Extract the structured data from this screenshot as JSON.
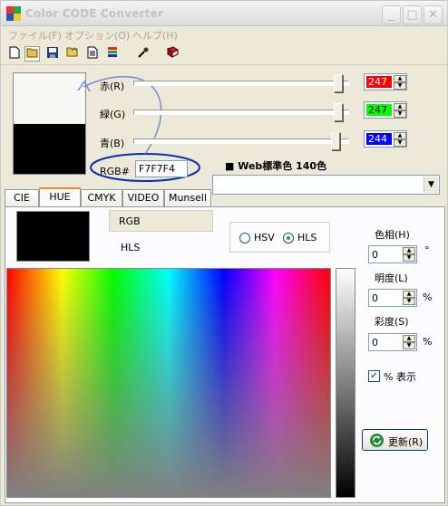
{
  "window": {
    "title": "Color CODE Converter"
  },
  "title_buttons": {
    "minimize": "_",
    "maximize": "□",
    "close": "✕"
  },
  "menu": [
    {
      "label": "ファイル(F)"
    },
    {
      "label": "オプション(O)"
    },
    {
      "label": "ヘルプ(H)"
    }
  ],
  "toolbar": [
    {
      "icon": "new-file-icon"
    },
    {
      "icon": "open-folder-icon"
    },
    {
      "icon": "save-icon"
    },
    {
      "icon": "open-icon"
    },
    {
      "icon": "document-icon"
    },
    {
      "icon": "palette-icon"
    },
    {
      "icon": "eyedropper-icon"
    },
    {
      "icon": "book-icon"
    }
  ],
  "colors": {
    "foreground": "#F7F7F4",
    "background": "#000000"
  },
  "sliders": [
    {
      "label": "赤(R)",
      "value": "247",
      "box_color": "#ff0000",
      "level": 0.969
    },
    {
      "label": "緑(G)",
      "value": "247",
      "box_color": "#00ff00",
      "level": 0.969
    },
    {
      "label": "青(B)",
      "value": "244",
      "box_color": "#0000ff",
      "level": 0.957
    }
  ],
  "rgb_code": {
    "label": "RGB#",
    "value": "F7F7F4"
  },
  "web_color": {
    "label": "■ Web標準色 140色",
    "selected": ""
  },
  "tabs": [
    {
      "label": "CIE",
      "active": false
    },
    {
      "label": "HUE",
      "active": true
    },
    {
      "label": "CMYK",
      "active": false
    },
    {
      "label": "VIDEO",
      "active": false
    },
    {
      "label": "Munsell",
      "active": false
    }
  ],
  "hue_panel": {
    "rgb_label": "RGB",
    "hls_label": "HLS",
    "mode_options": [
      {
        "label": "HSV",
        "selected": false
      },
      {
        "label": "HLS",
        "selected": true
      }
    ],
    "hue": {
      "label": "色相(H)",
      "value": "0",
      "unit": "°"
    },
    "lightness": {
      "label": "明度(L)",
      "value": "0",
      "unit": "%"
    },
    "saturation": {
      "label": "彩度(S)",
      "value": "0",
      "unit": "%"
    },
    "percent_checkbox": {
      "label": "% 表示",
      "checked": true
    },
    "update_button": {
      "label": "更新(R)"
    }
  }
}
